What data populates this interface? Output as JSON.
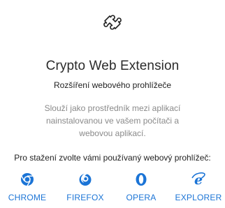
{
  "header": {
    "icon": "puzzle-piece-icon",
    "title": "Crypto Web Extension",
    "subtitle": "Rozšíření webového prohlížeče"
  },
  "description": {
    "line1": "Slouží jako prostředník mezi aplikací",
    "line2": "nainstalovanou ve vašem počítači a",
    "line3": "webovou aplikací."
  },
  "prompt": "Pro stažení zvolte vámi používaný webový prohlížeč:",
  "browsers": [
    {
      "label": "CHROME",
      "icon": "chrome-icon"
    },
    {
      "label": "FIREFOX",
      "icon": "firefox-icon"
    },
    {
      "label": "OPERA",
      "icon": "opera-icon"
    },
    {
      "label": "EXPLORER",
      "icon": "internet-explorer-icon"
    }
  ],
  "colors": {
    "accent": "#1b74d6",
    "text": "#222222",
    "muted": "#8a8a8a"
  }
}
